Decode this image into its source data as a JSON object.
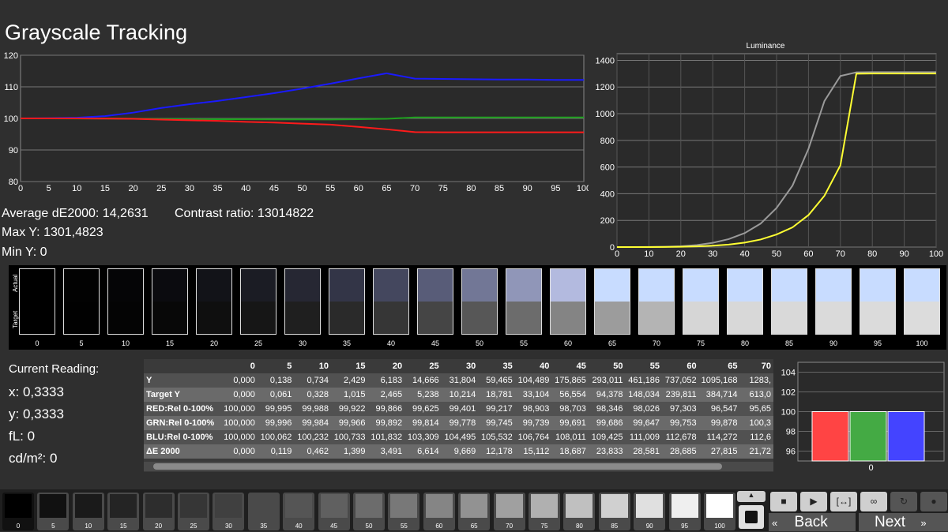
{
  "title": "Grayscale Tracking",
  "stats": {
    "avg_de": "Average dE2000: 14,2631",
    "contrast": "Contrast ratio: 13014822",
    "max_y": "Max Y: 1301,4823",
    "min_y": "Min Y: 0"
  },
  "chart_data": [
    {
      "type": "line",
      "title": "",
      "x": [
        0,
        5,
        10,
        15,
        20,
        25,
        30,
        35,
        40,
        45,
        50,
        55,
        60,
        65,
        70,
        75,
        80,
        85,
        90,
        95,
        100
      ],
      "ylim": [
        80,
        120
      ],
      "xlim": [
        0,
        100
      ],
      "yticks": [
        80,
        90,
        100,
        110,
        120
      ],
      "xticks": [
        0,
        5,
        10,
        15,
        20,
        25,
        30,
        35,
        40,
        45,
        50,
        55,
        60,
        65,
        70,
        75,
        80,
        85,
        90,
        95,
        100
      ],
      "series": [
        {
          "color": "#1a1aff",
          "values": [
            100,
            100.06,
            100.23,
            100.73,
            101.83,
            103.31,
            104.5,
            105.53,
            106.76,
            108.01,
            109.43,
            111.01,
            112.68,
            114.27,
            112.6,
            112.5,
            112.4,
            112.3,
            112.3,
            112.2,
            112.2
          ]
        },
        {
          "color": "#1fa01f",
          "values": [
            100,
            99.996,
            99.984,
            99.966,
            99.892,
            99.814,
            99.778,
            99.745,
            99.739,
            99.691,
            99.686,
            99.647,
            99.753,
            99.878,
            100.3,
            100.3,
            100.3,
            100.3,
            100.3,
            100.3,
            100.3
          ]
        },
        {
          "color": "#ff1a1a",
          "values": [
            100,
            99.995,
            99.988,
            99.922,
            99.866,
            99.625,
            99.401,
            99.217,
            98.903,
            98.703,
            98.346,
            98.026,
            97.303,
            96.547,
            95.65,
            95.6,
            95.6,
            95.6,
            95.6,
            95.6,
            95.6
          ]
        }
      ]
    },
    {
      "type": "line",
      "title": "Luminance",
      "x": [
        0,
        5,
        10,
        15,
        20,
        25,
        30,
        35,
        40,
        45,
        50,
        55,
        60,
        65,
        70,
        75,
        80,
        85,
        90,
        95,
        100
      ],
      "xlim": [
        0,
        100
      ],
      "ylim": [
        0,
        1450
      ],
      "yticks": [
        0,
        200,
        400,
        600,
        800,
        1000,
        1200,
        1400
      ],
      "xticks": [
        0,
        10,
        20,
        30,
        40,
        50,
        60,
        70,
        80,
        90,
        100
      ],
      "series": [
        {
          "color": "#9a9a9a",
          "values": [
            0,
            0.138,
            0.734,
            2.429,
            6.183,
            14.666,
            31.804,
            59.465,
            104.489,
            175.865,
            293.011,
            461.186,
            737.052,
            1095.168,
            1283,
            1310,
            1312,
            1312,
            1312,
            1312,
            1312
          ]
        },
        {
          "color": "#ffff33",
          "values": [
            0,
            0.061,
            0.328,
            1.015,
            2.465,
            5.238,
            10.214,
            18.781,
            33.104,
            56.554,
            94.378,
            148.034,
            239.811,
            384.714,
            613,
            1300,
            1301,
            1301,
            1301,
            1301,
            1301
          ]
        }
      ]
    },
    {
      "type": "bar",
      "categories": [
        "0"
      ],
      "ylim": [
        95,
        105
      ],
      "yticks": [
        96,
        98,
        100,
        102,
        104
      ],
      "series": [
        {
          "color": "#ff4444",
          "values": [
            100
          ]
        },
        {
          "color": "#44aa44",
          "values": [
            100
          ]
        },
        {
          "color": "#4444ff",
          "values": [
            100
          ]
        }
      ]
    }
  ],
  "swatches": {
    "actual_label": "Actual",
    "target_label": "Target",
    "items": [
      {
        "label": "0",
        "actual": "#000000",
        "target": "#000000"
      },
      {
        "label": "5",
        "actual": "#020202",
        "target": "#010101"
      },
      {
        "label": "10",
        "actual": "#050506",
        "target": "#040404"
      },
      {
        "label": "15",
        "actual": "#0b0b0f",
        "target": "#080808"
      },
      {
        "label": "20",
        "actual": "#121318",
        "target": "#0f0f0f"
      },
      {
        "label": "25",
        "actual": "#1b1c24",
        "target": "#161616"
      },
      {
        "label": "30",
        "actual": "#262733",
        "target": "#1f1f1f"
      },
      {
        "label": "35",
        "actual": "#333547",
        "target": "#2a2a2a"
      },
      {
        "label": "40",
        "actual": "#44475e",
        "target": "#363636"
      },
      {
        "label": "45",
        "actual": "#585c78",
        "target": "#454545"
      },
      {
        "label": "50",
        "actual": "#727796",
        "target": "#575757"
      },
      {
        "label": "55",
        "actual": "#9096b8",
        "target": "#6c6c6c"
      },
      {
        "label": "60",
        "actual": "#b3badf",
        "target": "#848484"
      },
      {
        "label": "65",
        "actual": "#c8dcff",
        "target": "#9c9c9c"
      },
      {
        "label": "70",
        "actual": "#c8dcff",
        "target": "#b4b4b4"
      },
      {
        "label": "75",
        "actual": "#c8dcff",
        "target": "#d6d6d6"
      },
      {
        "label": "80",
        "actual": "#c8dcff",
        "target": "#d8d8d8"
      },
      {
        "label": "85",
        "actual": "#c8dcff",
        "target": "#d9d9d9"
      },
      {
        "label": "90",
        "actual": "#c8dcff",
        "target": "#dadada"
      },
      {
        "label": "95",
        "actual": "#c8dcff",
        "target": "#dbdbdb"
      },
      {
        "label": "100",
        "actual": "#c8dcff",
        "target": "#dcdcdc"
      }
    ]
  },
  "reading": {
    "heading": "Current Reading:",
    "x": "x: 0,3333",
    "y": "y: 0,3333",
    "fl": "fL: 0",
    "cd": "cd/m²: 0"
  },
  "table": {
    "columns": [
      "0",
      "5",
      "10",
      "15",
      "20",
      "25",
      "30",
      "35",
      "40",
      "45",
      "50",
      "55",
      "60",
      "65",
      "70"
    ],
    "rows": [
      {
        "label": "Y",
        "values": [
          "0,000",
          "0,138",
          "0,734",
          "2,429",
          "6,183",
          "14,666",
          "31,804",
          "59,465",
          "104,489",
          "175,865",
          "293,011",
          "461,186",
          "737,052",
          "1095,168",
          "1283,"
        ]
      },
      {
        "label": "Target Y",
        "values": [
          "0,000",
          "0,061",
          "0,328",
          "1,015",
          "2,465",
          "5,238",
          "10,214",
          "18,781",
          "33,104",
          "56,554",
          "94,378",
          "148,034",
          "239,811",
          "384,714",
          "613,0"
        ]
      },
      {
        "label": "RED:Rel 0-100%",
        "values": [
          "100,000",
          "99,995",
          "99,988",
          "99,922",
          "99,866",
          "99,625",
          "99,401",
          "99,217",
          "98,903",
          "98,703",
          "98,346",
          "98,026",
          "97,303",
          "96,547",
          "95,65"
        ]
      },
      {
        "label": "GRN:Rel 0-100%",
        "values": [
          "100,000",
          "99,996",
          "99,984",
          "99,966",
          "99,892",
          "99,814",
          "99,778",
          "99,745",
          "99,739",
          "99,691",
          "99,686",
          "99,647",
          "99,753",
          "99,878",
          "100,3"
        ]
      },
      {
        "label": "BLU:Rel 0-100%",
        "values": [
          "100,000",
          "100,062",
          "100,232",
          "100,733",
          "101,832",
          "103,309",
          "104,495",
          "105,532",
          "106,764",
          "108,011",
          "109,425",
          "111,009",
          "112,678",
          "114,272",
          "112,6"
        ]
      },
      {
        "label": "ΔE 2000",
        "values": [
          "0,000",
          "0,119",
          "0,462",
          "1,399",
          "3,491",
          "6,614",
          "9,669",
          "12,178",
          "15,112",
          "18,687",
          "23,833",
          "28,581",
          "28,685",
          "27,815",
          "21,72"
        ]
      }
    ]
  },
  "bottom": {
    "tiles": [
      {
        "label": "0",
        "color": "#000000"
      },
      {
        "label": "5",
        "color": "#111111"
      },
      {
        "label": "10",
        "color": "#1a1a1a"
      },
      {
        "label": "15",
        "color": "#242424"
      },
      {
        "label": "20",
        "color": "#2d2d2d"
      },
      {
        "label": "25",
        "color": "#363636"
      },
      {
        "label": "30",
        "color": "#404040"
      },
      {
        "label": "35",
        "color": "#4a4a4a"
      },
      {
        "label": "40",
        "color": "#555555"
      },
      {
        "label": "45",
        "color": "#606060"
      },
      {
        "label": "50",
        "color": "#6c6c6c"
      },
      {
        "label": "55",
        "color": "#787878"
      },
      {
        "label": "60",
        "color": "#858585"
      },
      {
        "label": "65",
        "color": "#929292"
      },
      {
        "label": "70",
        "color": "#a0a0a0"
      },
      {
        "label": "75",
        "color": "#b0b0b0"
      },
      {
        "label": "80",
        "color": "#c0c0c0"
      },
      {
        "label": "85",
        "color": "#d0d0d0"
      },
      {
        "label": "90",
        "color": "#e0e0e0"
      },
      {
        "label": "95",
        "color": "#efefef"
      },
      {
        "label": "100",
        "color": "#ffffff"
      }
    ],
    "back": "Back",
    "next": "Next",
    "icons": [
      "stop-icon",
      "play-icon",
      "loop-bracket-icon",
      "infinity-icon",
      "refresh-icon",
      "circle-icon"
    ]
  }
}
